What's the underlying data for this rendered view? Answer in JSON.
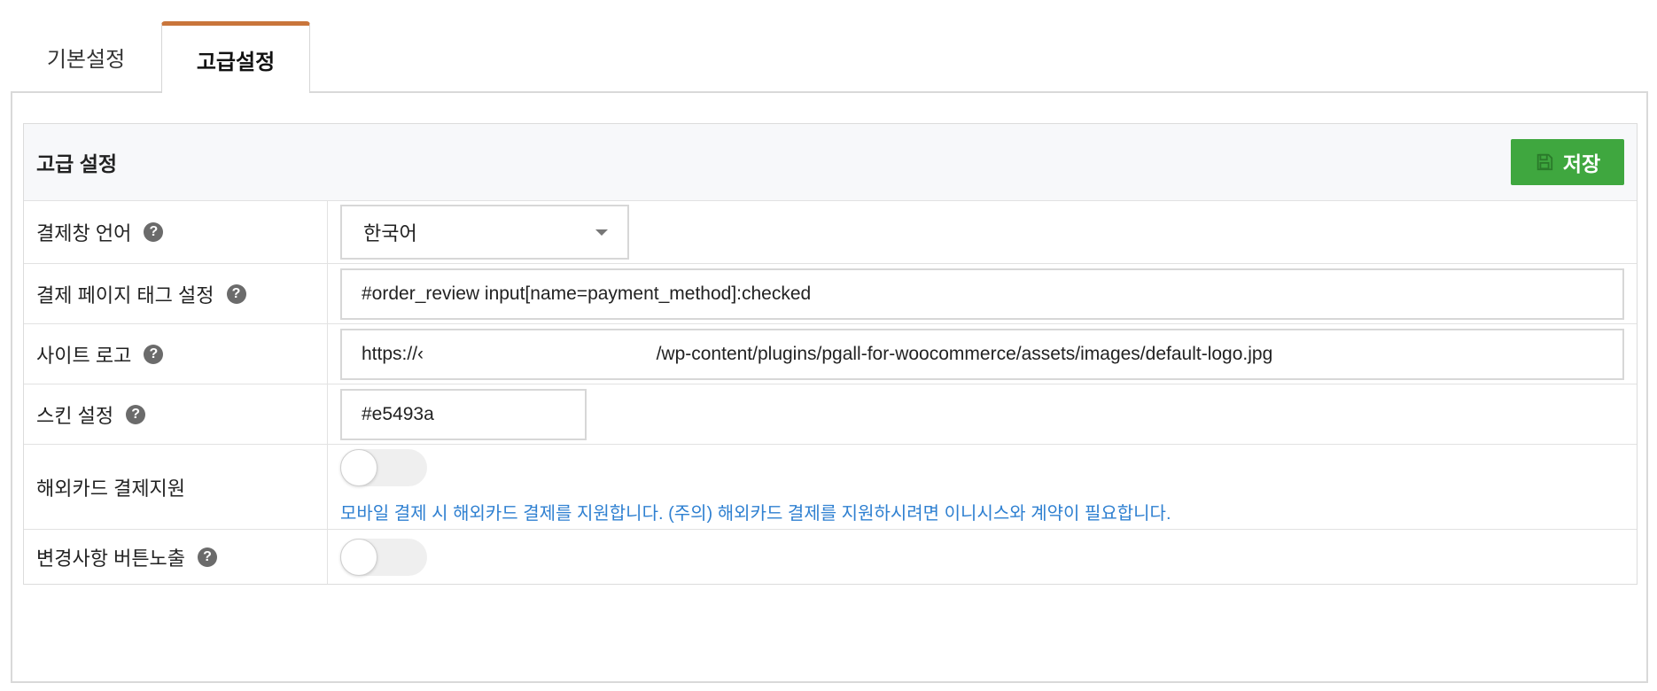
{
  "tabs": [
    {
      "label": "기본설정",
      "active": false
    },
    {
      "label": "고급설정",
      "active": true
    }
  ],
  "section": {
    "title": "고급 설정",
    "save_label": "저장"
  },
  "rows": {
    "language": {
      "label": "결제창 언어",
      "value": "한국어"
    },
    "page_tag": {
      "label": "결제 페이지 태그 설정",
      "value": "#order_review input[name=payment_method]:checked"
    },
    "logo": {
      "label": "사이트 로고",
      "value": "https://‹                                             /wp-content/plugins/pgall-for-woocommerce/assets/images/default-logo.jpg"
    },
    "skin": {
      "label": "스킨 설정",
      "value": "#e5493a"
    },
    "overseas": {
      "label": "해외카드 결제지원",
      "enabled": false,
      "note": "모바일 결제 시 해외카드 결제를 지원합니다. (주의) 해외카드 결제를 지원하시려면 이니시스와 계약이 필요합니다."
    },
    "change_button": {
      "label": "변경사항 버튼노출",
      "enabled": false
    }
  },
  "help_glyph": "?",
  "colors": {
    "accent_tab": "#c9753b",
    "save_button": "#3fa73f",
    "note_text": "#2f80d1"
  }
}
